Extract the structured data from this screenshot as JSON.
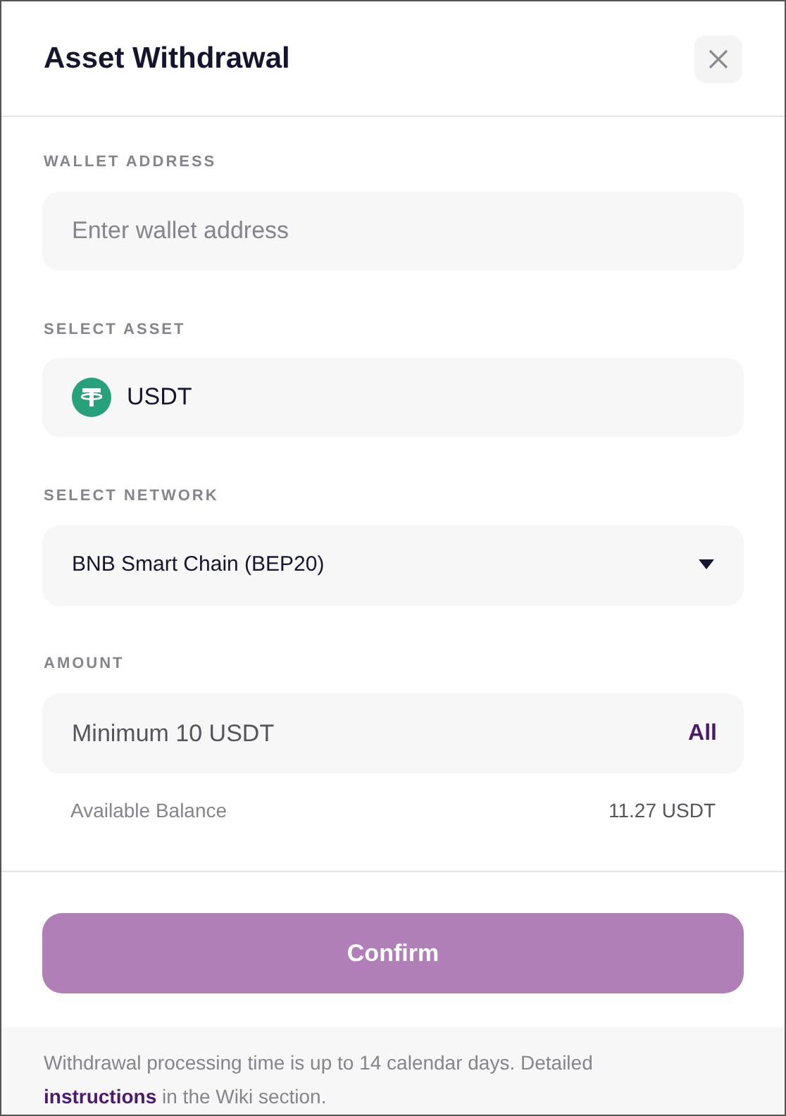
{
  "dialog": {
    "title": "Asset Withdrawal"
  },
  "wallet": {
    "label": "WALLET ADDRESS",
    "placeholder": "Enter wallet address"
  },
  "asset": {
    "label": "SELECT ASSET",
    "value": "USDT"
  },
  "network": {
    "label": "SELECT NETWORK",
    "value": "BNB Smart Chain (BEP20)"
  },
  "amount": {
    "label": "AMOUNT",
    "placeholder": "Minimum 10 USDT",
    "all_button": "All",
    "balance_label": "Available Balance",
    "balance_value": "11.27 USDT"
  },
  "confirm_button": {
    "label": "Confirm",
    "disabled": true
  },
  "footer": {
    "text_before": "Withdrawal processing time is up to 14 calendar days. Detailed",
    "link": "instructions",
    "text_after": "in the Wiki section."
  }
}
